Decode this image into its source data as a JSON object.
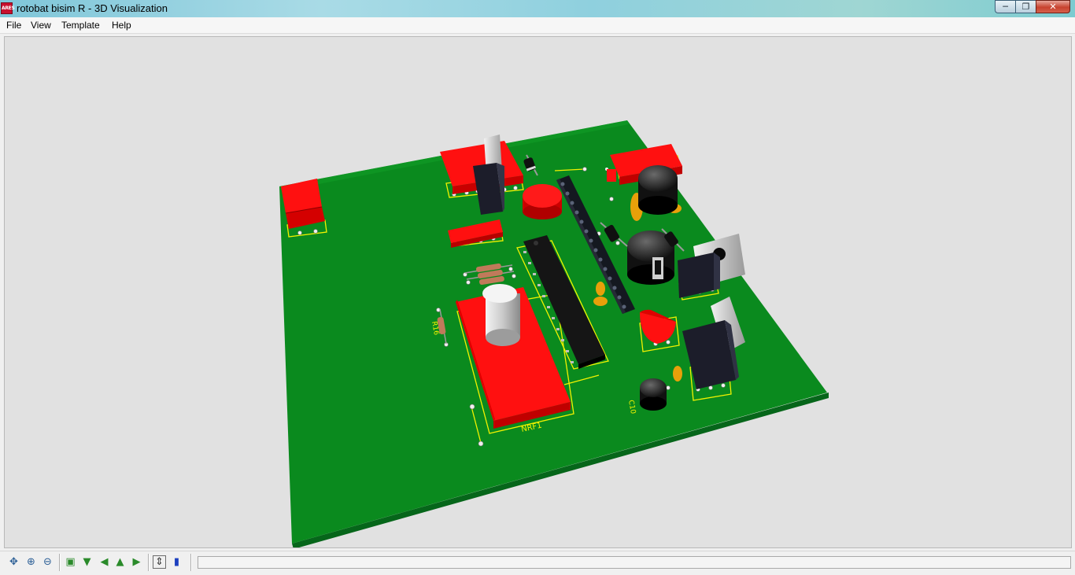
{
  "window": {
    "app_icon_text": "ARES",
    "title": "rotobat bisim R - 3D Visualization",
    "buttons": {
      "minimize": "─",
      "maximize": "❐",
      "close": "✕"
    }
  },
  "menu": {
    "items": [
      "File",
      "View",
      "Template",
      "Help"
    ]
  },
  "board": {
    "labels": {
      "rf_module": "NRF1",
      "cap_c10": "C10",
      "resistor": "R16"
    },
    "colors": {
      "pcb": "#0a8a1e",
      "pcb_edge": "#06661a",
      "background": "#e1e1e1",
      "component_red": "#ff0000",
      "silkscreen": "#f2f200"
    }
  },
  "toolbar": {
    "buttons": [
      {
        "name": "pan-icon",
        "glyph": "✥"
      },
      {
        "name": "zoom-in-icon",
        "glyph": "⊕"
      },
      {
        "name": "zoom-out-icon",
        "glyph": "⊖"
      },
      {
        "name": "view-top-icon",
        "glyph": "▣"
      },
      {
        "name": "view-front-icon",
        "glyph": "▼"
      },
      {
        "name": "view-left-icon",
        "glyph": "◀"
      },
      {
        "name": "view-back-icon",
        "glyph": "▲"
      },
      {
        "name": "view-right-icon",
        "glyph": "▶"
      },
      {
        "name": "board-height-icon",
        "glyph": "⇕"
      },
      {
        "name": "board-only-icon",
        "glyph": "▮"
      }
    ],
    "status_text": ""
  }
}
